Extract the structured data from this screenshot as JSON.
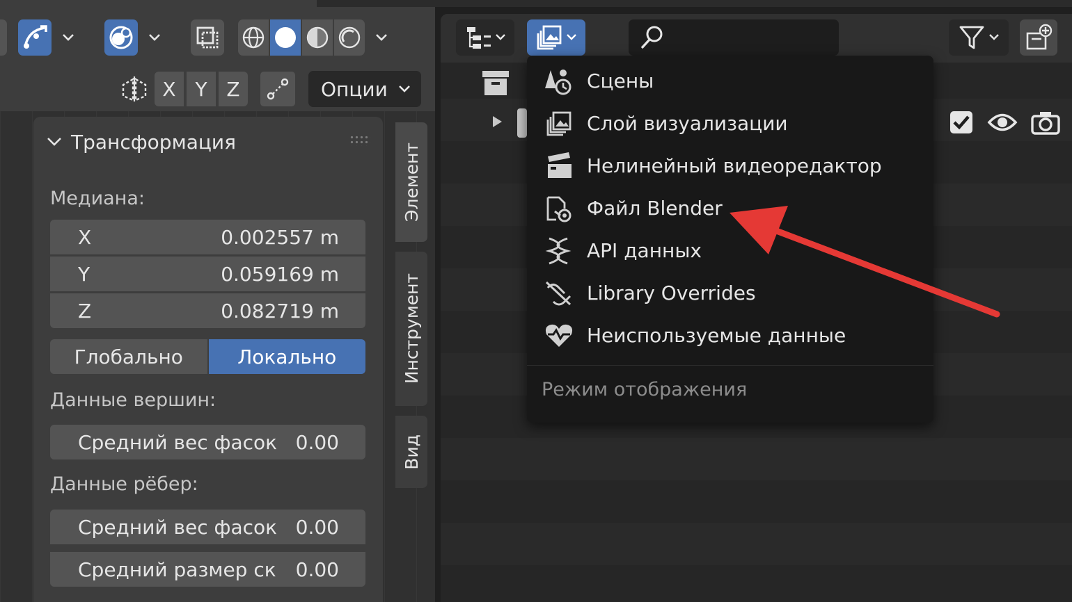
{
  "viewport_header": {
    "options_label": "Опции",
    "axes": [
      "X",
      "Y",
      "Z"
    ]
  },
  "sidebar": {
    "panel_title": "Трансформация",
    "median_label": "Медиана:",
    "median": [
      {
        "axis": "X",
        "value": "0.002557 m"
      },
      {
        "axis": "Y",
        "value": "0.059169 m"
      },
      {
        "axis": "Z",
        "value": "0.082719 m"
      }
    ],
    "coord_toggle": {
      "global": "Глобально",
      "local": "Локально",
      "selected": "local"
    },
    "vertex_data_label": "Данные вершин:",
    "vertex_fields": [
      {
        "label": "Средний вес фасок",
        "value": "0.00"
      }
    ],
    "edge_data_label": "Данные рёбер:",
    "edge_fields": [
      {
        "label": "Средний вес фасок",
        "value": "0.00"
      },
      {
        "label": "Средний размер ск",
        "value": "0.00"
      }
    ]
  },
  "vertical_tabs": [
    "Элемент",
    "Инструмент",
    "Вид"
  ],
  "display_mode_menu": {
    "items": [
      {
        "label": "Сцены",
        "icon": "scenes-icon"
      },
      {
        "label": "Слой визуализации",
        "icon": "view-layer-icon"
      },
      {
        "label": "Нелинейный видеоредактор",
        "icon": "sequencer-icon"
      },
      {
        "label": "Файл Blender",
        "icon": "blender-file-icon"
      },
      {
        "label": "API данных",
        "icon": "data-api-icon"
      },
      {
        "label": "Library Overrides",
        "icon": "library-overrides-icon"
      },
      {
        "label": "Неиспользуемые данные",
        "icon": "orphan-data-icon"
      }
    ],
    "footer_label": "Режим отображения"
  },
  "colors": {
    "accent_blue": "#4772b3",
    "annotation_arrow": "#e53935",
    "menu_bg": "#181818"
  }
}
